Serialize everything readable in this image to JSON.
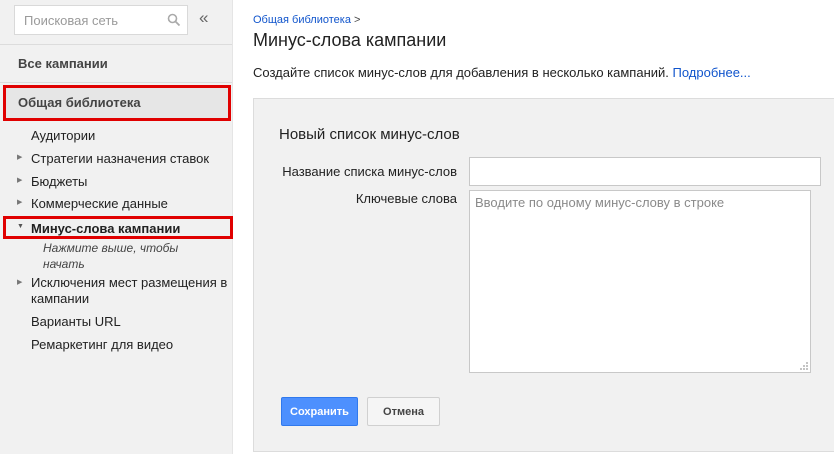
{
  "sidebar": {
    "search": {
      "placeholder": "Поисковая сеть",
      "icon": "search-icon"
    },
    "collapse_symbol": "«",
    "all_campaigns": "Все кампании",
    "library": "Общая библиотека",
    "items": [
      {
        "label": "Аудитории",
        "has_arrow": false
      },
      {
        "label": "Стратегии назначения ставок",
        "has_arrow": true
      },
      {
        "label": "Бюджеты",
        "has_arrow": true
      },
      {
        "label": "Коммерческие данные",
        "has_arrow": true
      },
      {
        "label": "Минус-слова кампании",
        "has_arrow": true,
        "active": true
      },
      {
        "label": "Исключения мест размещения в кампании",
        "has_arrow": true
      },
      {
        "label": "Варианты URL",
        "has_arrow": false
      },
      {
        "label": "Ремаркетинг для видео",
        "has_arrow": false
      }
    ],
    "active_hint": "Нажмите выше, чтобы начать"
  },
  "main": {
    "breadcrumb": {
      "link": "Общая библиотека",
      "separator": ">"
    },
    "title": "Минус-слова кампании",
    "description": "Создайте список минус-слов для добавления в несколько кампаний.",
    "more_link": "Подробнее...",
    "form": {
      "heading": "Новый список минус-слов",
      "name_label": "Название списка минус-слов",
      "name_value": "",
      "keywords_label": "Ключевые слова",
      "keywords_placeholder": "Вводите по одному минус-слову в строке",
      "save_label": "Сохранить",
      "cancel_label": "Отмена"
    }
  },
  "colors": {
    "highlight_border": "#e00000",
    "link": "#1155cc",
    "primary_button": "#4d90fe",
    "sidebar_bg": "#f1f1f1"
  }
}
